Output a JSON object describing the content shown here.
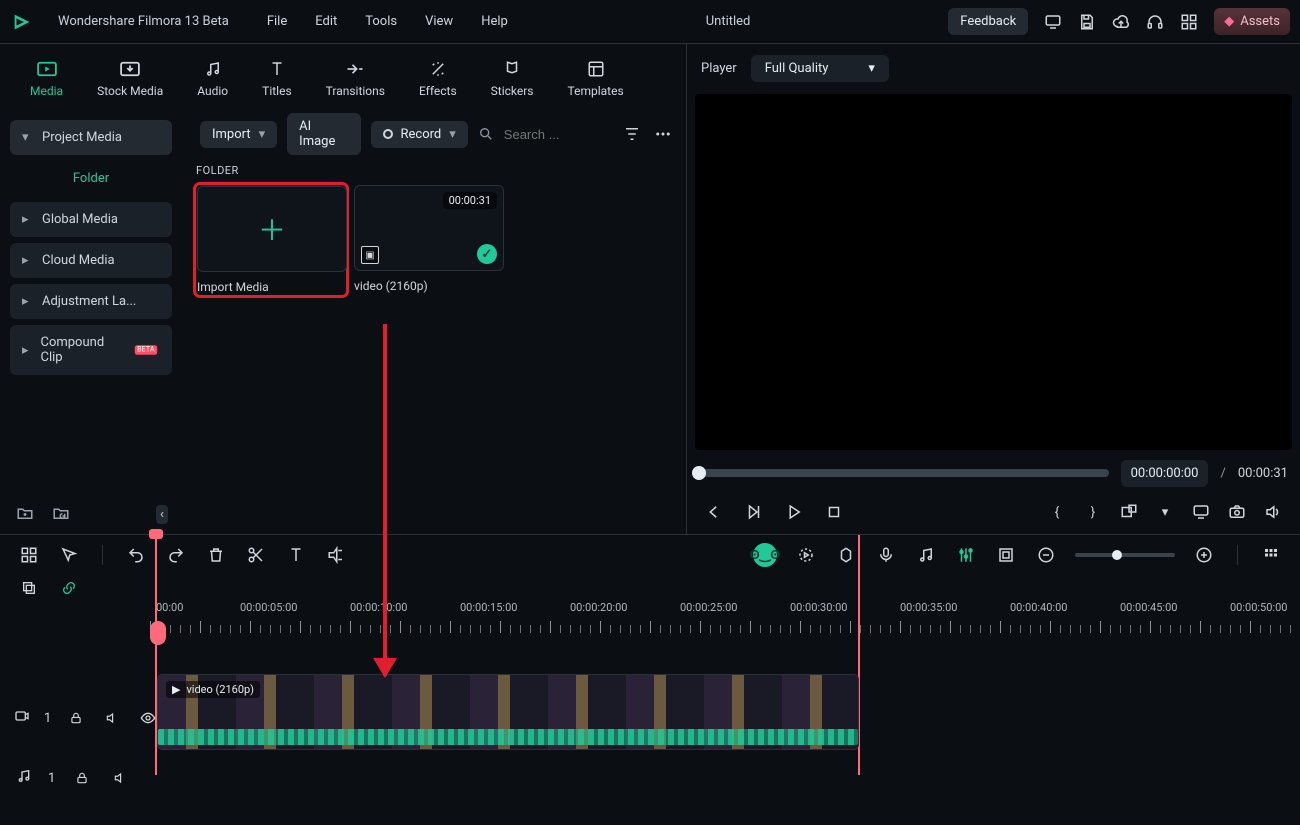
{
  "app": {
    "name": "Wondershare Filmora 13 Beta",
    "doc_title": "Untitled"
  },
  "menus": {
    "file": "File",
    "edit": "Edit",
    "tools": "Tools",
    "view": "View",
    "help": "Help"
  },
  "titlebar": {
    "feedback": "Feedback",
    "assets": "Assets"
  },
  "tabs": {
    "media": "Media",
    "stock": "Stock Media",
    "audio": "Audio",
    "titles": "Titles",
    "transitions": "Transitions",
    "effects": "Effects",
    "stickers": "Stickers",
    "templates": "Templates"
  },
  "sidebar": {
    "project_media": "Project Media",
    "folder": "Folder",
    "global": "Global Media",
    "cloud": "Cloud Media",
    "adjustment": "Adjustment La...",
    "compound": "Compound Clip",
    "beta": "BETA"
  },
  "toolbar": {
    "import": "Import",
    "ai_image": "AI Image",
    "record": "Record",
    "search_placeholder": "Search ..."
  },
  "content": {
    "folder_label": "FOLDER",
    "import_media": "Import Media",
    "clip_name": "video (2160p)",
    "clip_duration": "00:00:31"
  },
  "player": {
    "label": "Player",
    "quality": "Full Quality",
    "current": "00:00:00:00",
    "slash": "/",
    "total": "00:00:31"
  },
  "timeline": {
    "ruler_labels": [
      "00:00",
      "00:00:05:00",
      "00:00:10:00",
      "00:00:15:00",
      "00:00:20:00",
      "00:00:25:00",
      "00:00:30:00",
      "00:00:35:00",
      "00:00:40:00",
      "00:00:45:00",
      "00:00:50:00"
    ],
    "video_track": "1",
    "audio_track": "1",
    "clip_name": "video (2160p)"
  }
}
